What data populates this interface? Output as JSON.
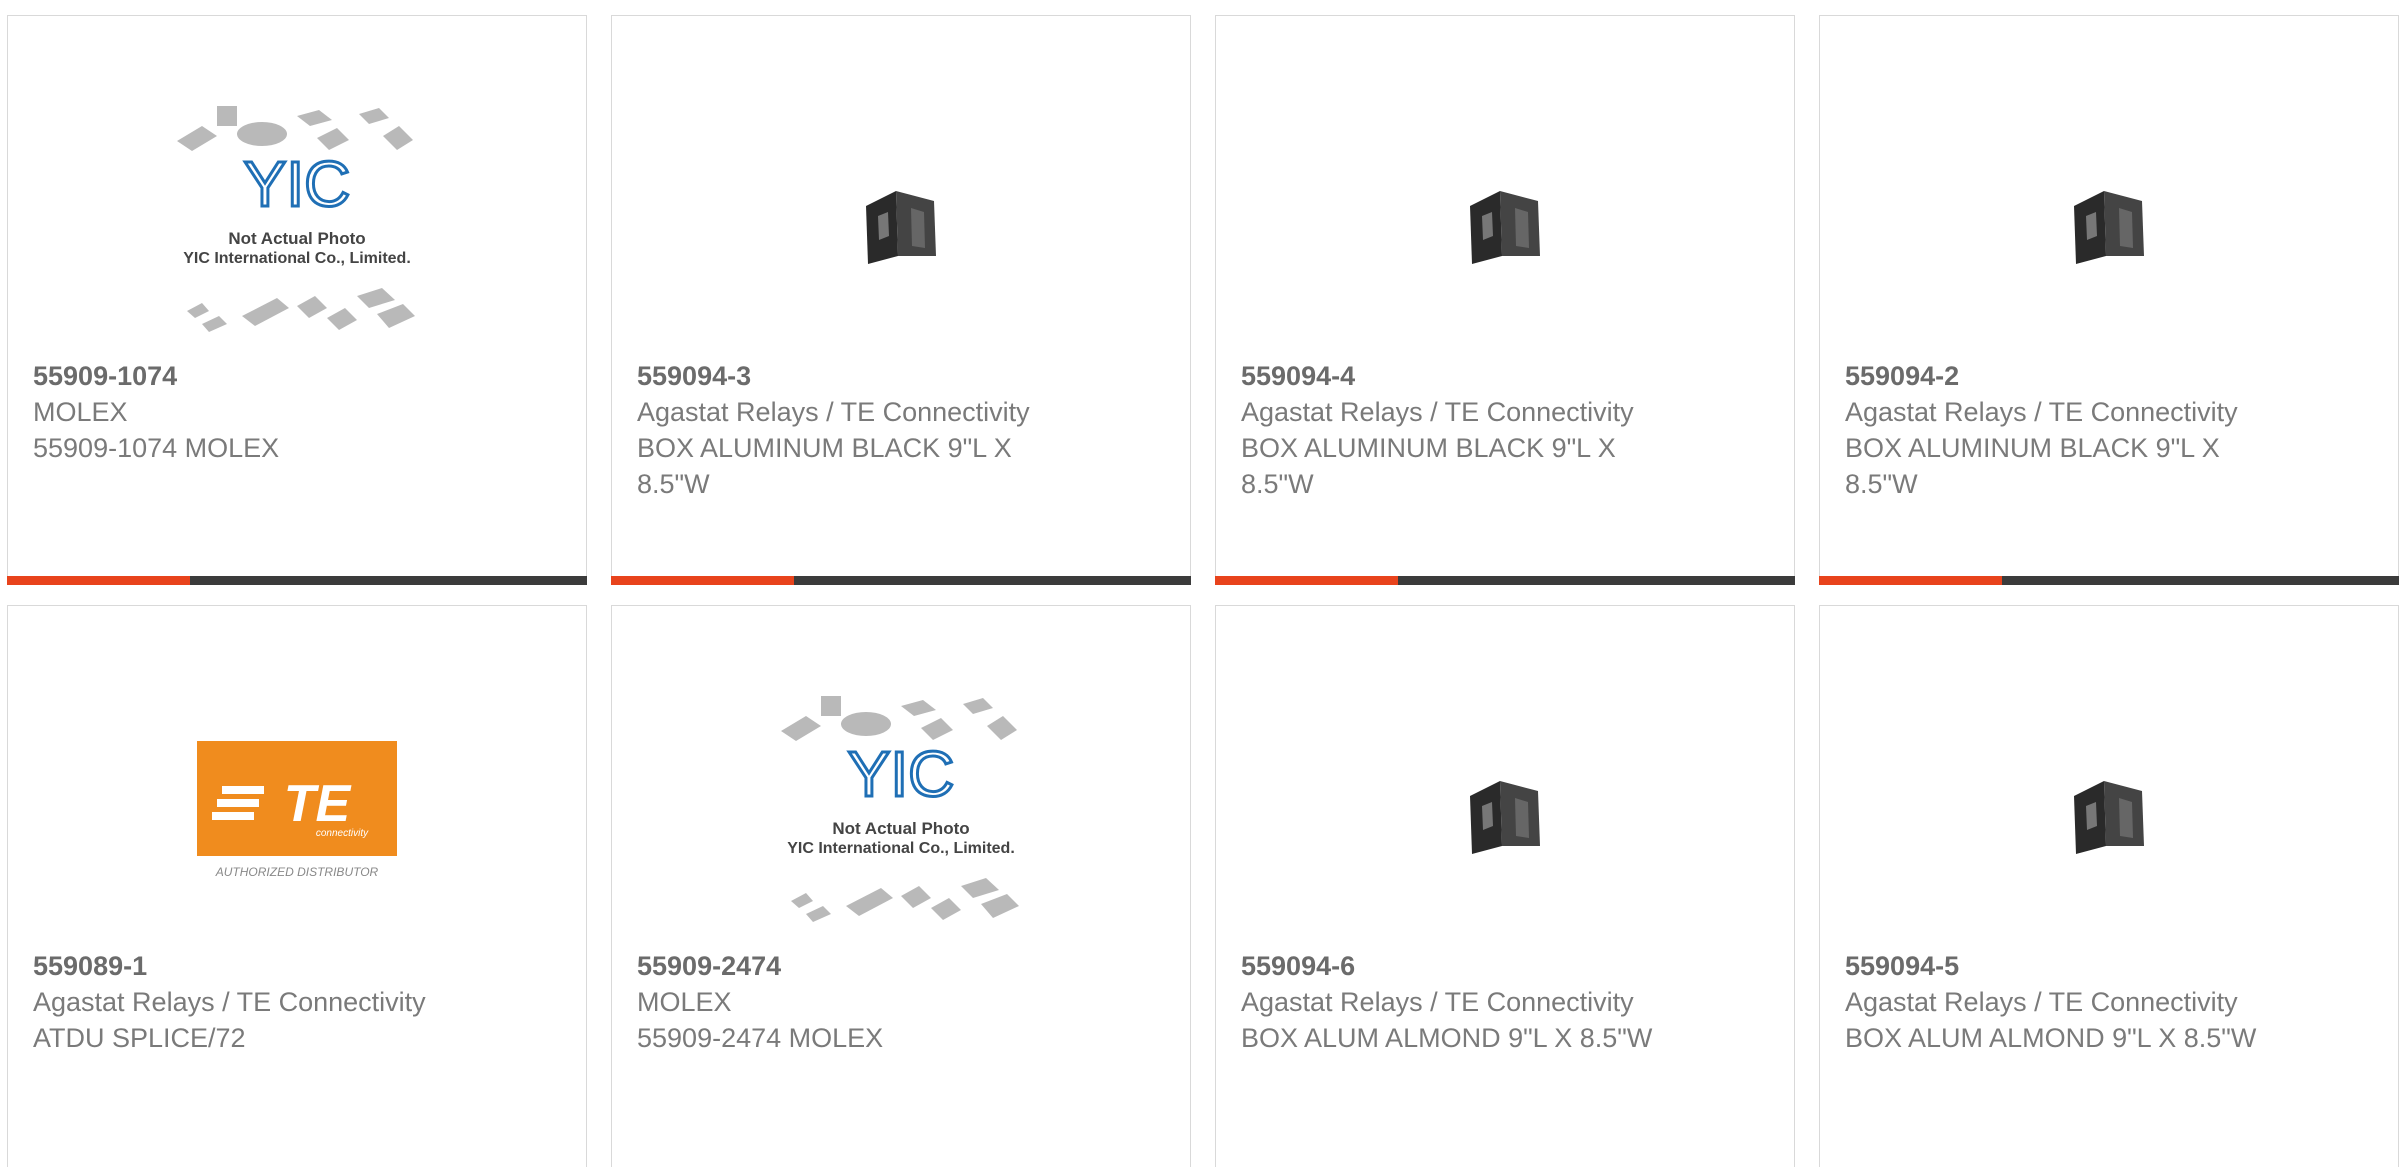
{
  "colors": {
    "accent": "#e8431c",
    "bar_dark": "#3b3b3b",
    "text": "#7a7a7a",
    "te_orange": "#f08c1e"
  },
  "products": [
    {
      "part_number": "55909-1074",
      "manufacturer": "MOLEX",
      "description": "55909-1074 MOLEX",
      "image": "yic-placeholder",
      "image_text": {
        "line1": "Not Actual Photo",
        "line2": "YIC International Co., Limited.",
        "logo": "YIC"
      }
    },
    {
      "part_number": "559094-3",
      "manufacturer": "Agastat Relays / TE Connectivity",
      "description": "BOX ALUMINUM BLACK 9\"L X 8.5\"W",
      "image": "black-box-bracket"
    },
    {
      "part_number": "559094-4",
      "manufacturer": "Agastat Relays / TE Connectivity",
      "description": "BOX ALUMINUM BLACK 9\"L X 8.5\"W",
      "image": "black-box-bracket"
    },
    {
      "part_number": "559094-2",
      "manufacturer": "Agastat Relays / TE Connectivity",
      "description": "BOX ALUMINUM BLACK 9\"L X 8.5\"W",
      "image": "black-box-bracket"
    },
    {
      "part_number": "559089-1",
      "manufacturer": "Agastat Relays / TE Connectivity",
      "description": "ATDU SPLICE/72",
      "image": "te-authorized-distributor",
      "image_text": {
        "logo": "TE",
        "sub": "connectivity",
        "caption": "AUTHORIZED DISTRIBUTOR"
      }
    },
    {
      "part_number": "55909-2474",
      "manufacturer": "MOLEX",
      "description": "55909-2474 MOLEX",
      "image": "yic-placeholder",
      "image_text": {
        "line1": "Not Actual Photo",
        "line2": "YIC International Co., Limited.",
        "logo": "YIC"
      }
    },
    {
      "part_number": "559094-6",
      "manufacturer": "Agastat Relays / TE Connectivity",
      "description": "BOX ALUM ALMOND 9\"L X 8.5\"W",
      "image": "black-box-bracket"
    },
    {
      "part_number": "559094-5",
      "manufacturer": "Agastat Relays / TE Connectivity",
      "description": "BOX ALUM ALMOND 9\"L X 8.5\"W",
      "image": "black-box-bracket"
    }
  ]
}
